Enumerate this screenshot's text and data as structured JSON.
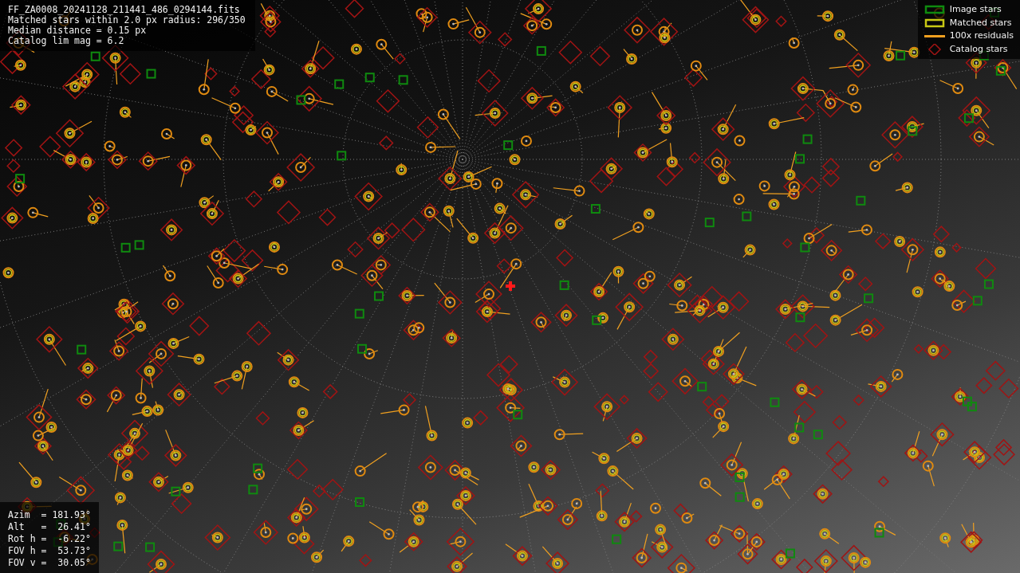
{
  "info": {
    "lines": [
      "FF_ZA0008_20241128_211441_486_0294144.fits",
      "Matched stars within 2.0 px radius: 296/350",
      "Median distance = 0.15 px",
      "Catalog lim mag = 6.2"
    ]
  },
  "legend": [
    {
      "label": "Image stars",
      "kind": "square",
      "color": "#0f8a0f"
    },
    {
      "label": "Matched stars",
      "kind": "rect",
      "color": "#c8c814"
    },
    {
      "label": "100x residuals",
      "kind": "line",
      "color": "#f0a020"
    },
    {
      "label": "Catalog stars",
      "kind": "diamond",
      "color": "#a01414"
    }
  ],
  "pointing": [
    {
      "label": "Azim  =",
      "value": "181.93°"
    },
    {
      "label": "Alt   =",
      "value": " 26.41°"
    },
    {
      "label": "Rot h =",
      "value": " -6.22°"
    },
    {
      "label": "FOV h =",
      "value": " 53.73°"
    },
    {
      "label": "FOV v =",
      "value": " 30.05°"
    }
  ]
}
